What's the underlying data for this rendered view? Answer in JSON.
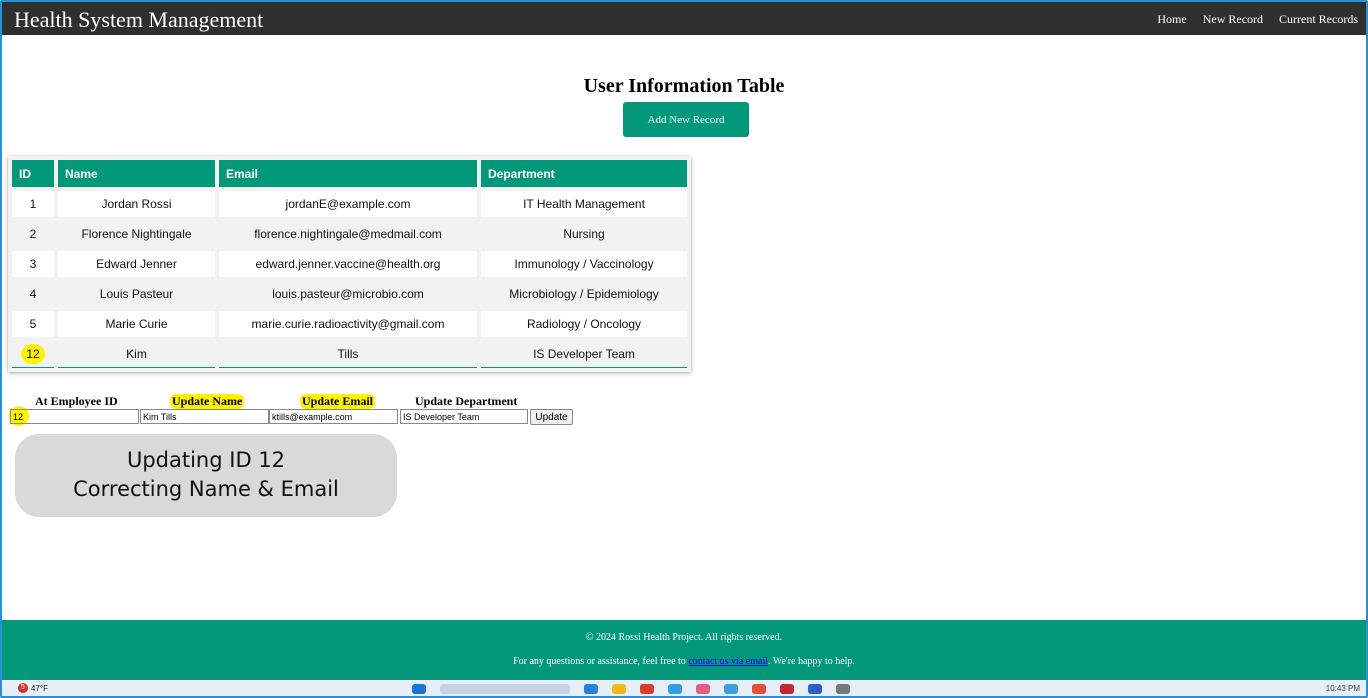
{
  "app": {
    "title": "Health System Management",
    "nav": [
      "Home",
      "New Record",
      "Current Records"
    ]
  },
  "main": {
    "heading": "User Information Table",
    "add_button": "Add New Record"
  },
  "table": {
    "headers": [
      "ID",
      "Name",
      "Email",
      "Department"
    ],
    "rows": [
      {
        "id": "1",
        "name": "Jordan Rossi",
        "email": "jordanE@example.com",
        "department": "IT Health Management"
      },
      {
        "id": "2",
        "name": "Florence Nightingale",
        "email": "florence.nightingale@medmail.com",
        "department": "Nursing"
      },
      {
        "id": "3",
        "name": "Edward Jenner",
        "email": "edward.jenner.vaccine@health.org",
        "department": "Immunology / Vaccinology"
      },
      {
        "id": "4",
        "name": "Louis Pasteur",
        "email": "louis.pasteur@microbio.com",
        "department": "Microbiology / Epidemiology"
      },
      {
        "id": "5",
        "name": "Marie Curie",
        "email": "marie.curie.radioactivity@gmail.com",
        "department": "Radiology / Oncology"
      },
      {
        "id": "12",
        "name": "Kim",
        "email": "Tills",
        "department": "IS Developer Team"
      }
    ]
  },
  "update_form": {
    "labels": {
      "id": "At Employee ID",
      "name": "Update Name",
      "email": "Update Email",
      "department": "Update Department"
    },
    "values": {
      "id": "12",
      "name": "Kim Tills",
      "email": "ktills@example.com",
      "department": "IS Developer Team"
    },
    "button": "Update"
  },
  "annotation": {
    "line1": "Updating ID 12",
    "line2": "Correcting Name & Email"
  },
  "footer": {
    "copyright": "© 2024 Rossi Health Project. All rights reserved.",
    "help_before": "For any questions or assistance, feel free to ",
    "help_link": "contact us via email",
    "help_after": ". We're happy to help."
  },
  "taskbar": {
    "weather": "47°F",
    "notification_count": "5",
    "clock": "10:43 PM"
  },
  "colors": {
    "accent": "#04987a",
    "topbar": "#2f2f2f",
    "highlight": "#fff200"
  }
}
